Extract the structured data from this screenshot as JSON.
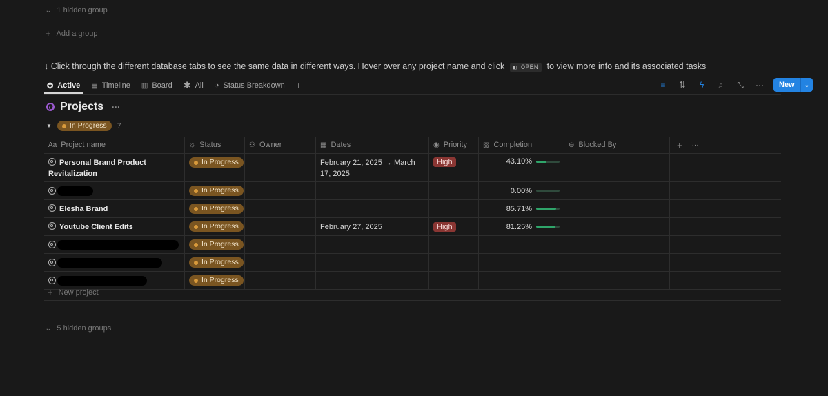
{
  "top": {
    "hidden_group_label": "1 hidden group",
    "add_group_label": "Add a group"
  },
  "hint": {
    "prefix": "↓ Click through the different database tabs to see the same data in different ways. Hover over any project name and click",
    "kbd": "OPEN",
    "suffix": "to view more info and its associated tasks"
  },
  "tabs": [
    {
      "label": "Active",
      "icon": "star-circle-icon",
      "active": true
    },
    {
      "label": "Timeline",
      "icon": "timeline-icon"
    },
    {
      "label": "Board",
      "icon": "board-icon"
    },
    {
      "label": "All",
      "icon": "asterisk-icon"
    },
    {
      "label": "Status Breakdown",
      "icon": "pie-icon"
    }
  ],
  "toolbar": {
    "new_label": "New"
  },
  "database": {
    "title": "Projects"
  },
  "group": {
    "status": "In Progress",
    "count": "7"
  },
  "columns": [
    {
      "label": "Project name",
      "icon": "Aa"
    },
    {
      "label": "Status",
      "icon": "☼"
    },
    {
      "label": "Owner",
      "icon": "👥"
    },
    {
      "label": "Dates",
      "icon": "▦"
    },
    {
      "label": "Priority",
      "icon": "◉"
    },
    {
      "label": "Completion",
      "icon": "▨"
    },
    {
      "label": "Blocked By",
      "icon": "⊖"
    }
  ],
  "rows": [
    {
      "name": "Personal Brand Product Revitalization",
      "status": "In Progress",
      "dates": "February 21, 2025 → March 17, 2025",
      "priority": "High",
      "completion": "43.10%",
      "progress": 0.431
    },
    {
      "name": "",
      "redacted": true,
      "status": "In Progress",
      "dates": "",
      "priority": "",
      "completion": "0.00%",
      "progress": 0.0
    },
    {
      "name": "Elesha Brand",
      "status": "In Progress",
      "dates": "",
      "priority": "",
      "completion": "85.71%",
      "progress": 0.8571
    },
    {
      "name": "Youtube Client Edits",
      "status": "In Progress",
      "dates": "February 27, 2025",
      "priority": "High",
      "completion": "81.25%",
      "progress": 0.8125
    },
    {
      "name": "",
      "redacted": true,
      "status": "In Progress",
      "dates": "",
      "priority": "",
      "completion": "",
      "progress": null
    },
    {
      "name": "",
      "redacted": true,
      "status": "In Progress",
      "dates": "",
      "priority": "",
      "completion": "",
      "progress": null
    },
    {
      "name": "",
      "redacted": true,
      "status": "In Progress",
      "dates": "",
      "priority": "",
      "completion": "",
      "progress": null
    }
  ],
  "new_project_label": "New project",
  "bottom": {
    "hidden_groups_label": "5 hidden groups"
  },
  "colors": {
    "accent": "#2383e2",
    "status_pill": "#7a5521",
    "priority_high": "#8a3633",
    "progress": "#2fa56a"
  }
}
